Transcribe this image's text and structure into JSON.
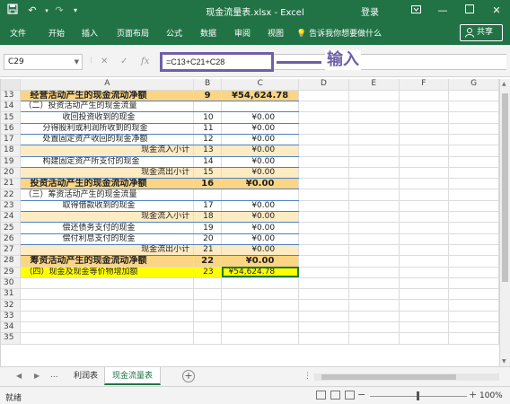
{
  "titlebar": {
    "document_title": "现金流量表.xlsx - Excel",
    "login": "登录",
    "icons": [
      "save-icon",
      "undo-icon",
      "redo-icon",
      "customize-icon",
      "ribbon-display-icon",
      "minimize-icon",
      "restore-icon",
      "close-icon"
    ]
  },
  "ribbon": {
    "tabs": [
      "文件",
      "开始",
      "插入",
      "页面布局",
      "公式",
      "数据",
      "审阅",
      "视图"
    ],
    "tell_me": "告诉我你想要做什么",
    "share": "共享"
  },
  "formula_bar": {
    "name_box": "C29",
    "formula": "=C13+C21+C28",
    "annotation": "输入"
  },
  "grid": {
    "columns": [
      "A",
      "B",
      "C",
      "D",
      "E",
      "F",
      "G"
    ],
    "rows": [
      {
        "row": "13",
        "a": "经营活动产生的现金流动净额",
        "b": "9",
        "c": "¥54,624.78"
      },
      {
        "row": "14",
        "a": "（二）投资活动产生的现金流量",
        "b": "",
        "c": ""
      },
      {
        "row": "15",
        "a": "收回投资收到的现金",
        "b": "10",
        "c": "¥0.00"
      },
      {
        "row": "16",
        "a": "分得股利或利润所收到的现金",
        "b": "11",
        "c": "¥0.00"
      },
      {
        "row": "17",
        "a": "处置固定资产收回的现金净额",
        "b": "12",
        "c": "¥0.00"
      },
      {
        "row": "18",
        "a": "现金流入小计",
        "b": "13",
        "c": "¥0.00"
      },
      {
        "row": "19",
        "a": "构建固定资产所支付的现金",
        "b": "14",
        "c": "¥0.00"
      },
      {
        "row": "20",
        "a": "现金流出小计",
        "b": "15",
        "c": "¥0.00"
      },
      {
        "row": "21",
        "a": "投资活动产生的现金流动净额",
        "b": "16",
        "c": "¥0.00"
      },
      {
        "row": "22",
        "a": "（三）筹资活动产生的现金流量",
        "b": "",
        "c": ""
      },
      {
        "row": "23",
        "a": "取得借款收到的现金",
        "b": "17",
        "c": "¥0.00"
      },
      {
        "row": "24",
        "a": "现金流入小计",
        "b": "18",
        "c": "¥0.00"
      },
      {
        "row": "25",
        "a": "偿还债务支付的现金",
        "b": "19",
        "c": "¥0.00"
      },
      {
        "row": "26",
        "a": "偿付利息支付的现金",
        "b": "20",
        "c": "¥0.00"
      },
      {
        "row": "27",
        "a": "现金流出小计",
        "b": "21",
        "c": "¥0.00"
      },
      {
        "row": "28",
        "a": "筹资活动产生的现金流动净额",
        "b": "22",
        "c": "¥0.00"
      },
      {
        "row": "29",
        "a": "（四）现金及现金等价物增加额",
        "b": "23",
        "c": "¥54,624.78"
      },
      {
        "row": "30",
        "a": "",
        "b": "",
        "c": ""
      },
      {
        "row": "31",
        "a": "",
        "b": "",
        "c": ""
      },
      {
        "row": "32",
        "a": "",
        "b": "",
        "c": ""
      },
      {
        "row": "33",
        "a": "",
        "b": "",
        "c": ""
      },
      {
        "row": "34",
        "a": "",
        "b": "",
        "c": ""
      },
      {
        "row": "35",
        "a": "",
        "b": "",
        "c": ""
      }
    ]
  },
  "sheet_tabs": {
    "more": "...",
    "tabs": [
      "利润表",
      "现金流量表"
    ],
    "active": "现金流量表"
  },
  "status_bar": {
    "status": "就绪",
    "zoom_level": "100%"
  },
  "colors": {
    "excel_green": "#217346",
    "annotation_purple": "#6f5fa8",
    "bold_row_fill": "#fbd584",
    "subtotal_fill": "#fdebc4",
    "selected_row_fill": "#ffff00"
  }
}
